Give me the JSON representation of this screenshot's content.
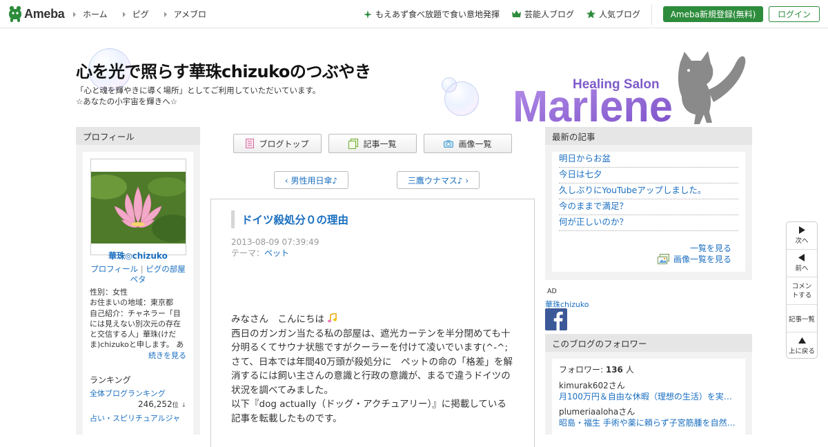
{
  "header": {
    "logo_text": "Ameba",
    "nav": [
      "ホーム",
      "ピグ",
      "アメブロ"
    ],
    "promos": [
      {
        "label": "もえあず食べ放題で食い意地発揮",
        "icon": "sparkle-icon"
      },
      {
        "label": "芸能人ブログ",
        "icon": "crown-icon"
      },
      {
        "label": "人気ブログ",
        "icon": "star-icon"
      }
    ],
    "register_label": "Ameba新規登録(無料)",
    "login_label": "ログイン"
  },
  "blog": {
    "title": "心を光で照らす華珠chizukoのつぶやき",
    "desc_line1": "「心と魂を輝やきに導く場所」としてご利用していただいています。",
    "desc_line2": "☆あなたの小宇宙を輝きへ☆",
    "banner_small": "Healing Salon",
    "banner_big": "Marlene"
  },
  "profile": {
    "heading": "プロフィール",
    "name": "華珠◎chizuko",
    "links": [
      "プロフィール",
      "ピグの部屋",
      "ペタ"
    ],
    "gender": "性別：女性",
    "region": "お住まいの地域：東京都",
    "intro": "自己紹介：チャネラー「目には見えない別次元の存在と交信する人」華珠(けだま)chizukoと申します。 あの…",
    "more": "続きを見る",
    "ranking_heading": "ランキング",
    "ranking_label": "全体ブログランキング",
    "ranking_value": "246,252",
    "ranking_unit": "位",
    "ranking_arrow": "↓",
    "ranking_label2": "占い・スピリチュアルジャ"
  },
  "tabs": [
    "ブログトップ",
    "記事一覧",
    "画像一覧"
  ],
  "pager": {
    "prev": "‹ 男性用日傘♪",
    "next": "三鷹ウナマス♪ ›"
  },
  "article": {
    "title": "ドイツ殺処分０の理由",
    "date": "2013-08-09 07:39:49",
    "theme_label": "テーマ：",
    "theme": "ペット",
    "greeting": "みなさん　こんにちは",
    "p1": "西日のガンガン当たる私の部屋は、遮光カーテンを半分閉めても十分明るくてサウナ状態ですがクーラーを付けて凌いでいます(^-^;",
    "p2": "さて、日本では年間40万頭が殺処分に　ペットの命の「格差」を解消するには飼い主さんの意識と行政の意識が、まるで違うドイツの状況を調べてみました。",
    "p3": "以下『dog actually（ドッグ・アクチュアリー）』に掲載している記事を転載したものです。"
  },
  "recent": {
    "heading": "最新の記事",
    "items": [
      "明日からお盆",
      "今日は七夕",
      "久しぶりにYouTubeアップしました。",
      "今のままで満足？",
      "何が正しいのか？"
    ],
    "see_all": "一覧を見る",
    "see_images": "画像一覧を見る"
  },
  "ad": {
    "label": "AD",
    "name": "華珠chizuko"
  },
  "followers": {
    "heading": "このブログのフォロワー",
    "count_label": "フォロワー: ",
    "count": "136",
    "count_unit": " 人",
    "list": [
      {
        "user": "kimurak602さん",
        "post": "月100万円＆自由な休暇（理想の生活）を実…"
      },
      {
        "user": "plumeriaalohaさん",
        "post": "昭島・福生 手術や薬に頼らず子宮筋腫を自然…"
      }
    ]
  },
  "floatnav": {
    "next": "次へ",
    "prev": "前へ",
    "comment": "コメントする",
    "list": "記事一覧",
    "top": "上に戻る"
  }
}
